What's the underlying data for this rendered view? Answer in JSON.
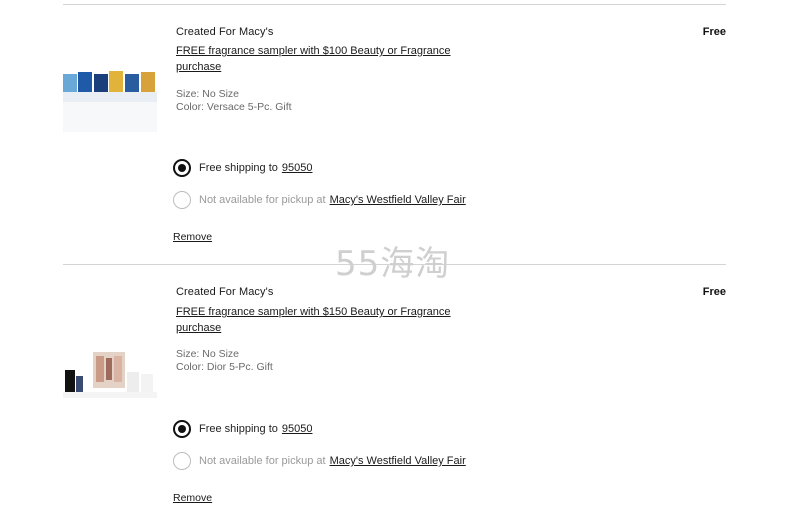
{
  "items": [
    {
      "brand": "Created For Macy's",
      "title": "FREE fragrance sampler with $100 Beauty or Fragrance purchase",
      "price": "Free",
      "size": "Size: No Size",
      "color": "Color: Versace 5-Pc. Gift",
      "shipping_label": "Free shipping to",
      "zip": "95050",
      "pickup_label": "Not available for pickup at",
      "store": "Macy's Westfield Valley Fair",
      "remove_label": "Remove"
    },
    {
      "brand": "Created For Macy's",
      "title": "FREE fragrance sampler with $150 Beauty or Fragrance purchase",
      "price": "Free",
      "size": "Size: No Size",
      "color": "Color: Dior 5-Pc. Gift",
      "shipping_label": "Free shipping to",
      "zip": "95050",
      "pickup_label": "Not available for pickup at",
      "store": "Macy's Westfield Valley Fair",
      "remove_label": "Remove"
    }
  ],
  "watermark": "55海淘",
  "colors": {
    "text": "#1a1a1a",
    "muted": "#6a6a6a",
    "disabled": "#9a9a9a",
    "divider": "#d4d4d4"
  }
}
